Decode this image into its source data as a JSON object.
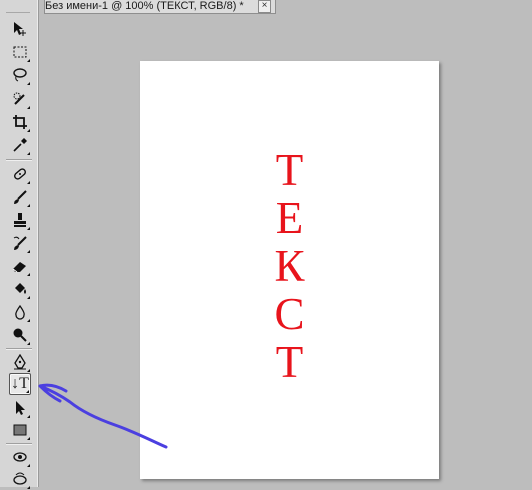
{
  "document": {
    "tab_title": "Без имени-1 @ 100% (ТЕКСТ, RGB/8) *",
    "close_glyph": "×"
  },
  "canvas": {
    "text_color": "#e8141c",
    "vertical_text": [
      "Т",
      "Е",
      "К",
      "С",
      "Т"
    ]
  },
  "tools": {
    "type_tool_label": "↓T",
    "active_tool": "vertical-type-tool"
  },
  "annotation": {
    "color": "#4b3fe0"
  }
}
